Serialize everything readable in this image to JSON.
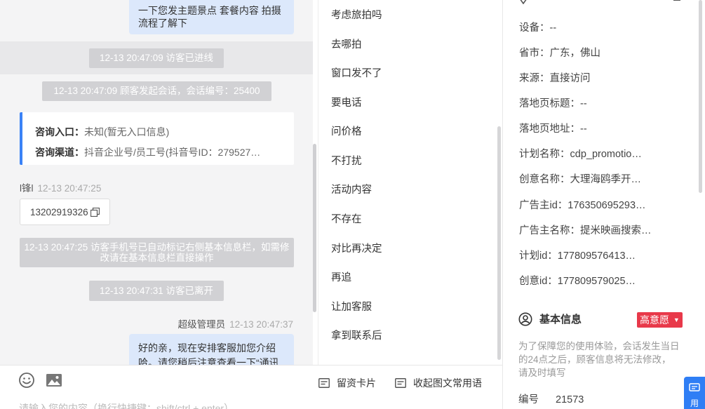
{
  "chat": {
    "bubble_top": "一下您发主题景点 套餐内容 拍摄流程了解下",
    "sys_visitor_in": "12-13 20:47:09 访客已进线",
    "sys_session_start": "12-13 20:47:09 顾客发起会话，会话编号：25400",
    "info_card": {
      "entry_label": "咨询入口：",
      "entry_value": "未知(暂无入口信息)",
      "channel_label": "咨询渠道：",
      "channel_value": "抖音企业号/员工号(抖音号ID：279527…"
    },
    "visitor_name": "l锋l",
    "visitor_time": "12-13 20:47:25",
    "visitor_phone": "13202919326",
    "sys_phone_marked": "12-13 20:47:25 访客手机号已自动标记右侧基本信息栏，如需修改请在基本信息栏直接操作",
    "sys_visitor_left": "12-13 20:47:31 访客已离开",
    "admin_name": "超级管理员",
    "admin_time": "12-13 20:47:37",
    "bubble_admin": "好的亲，现在安排客服加您介绍哈。请您稍后注意查看一下“通讯"
  },
  "input": {
    "emoji_icon": "smile-icon",
    "image_icon": "image-icon",
    "card_label": "留资卡片",
    "collapse_label": "收起图文常用语",
    "placeholder": "请输入您的内容（换行快捷键：shift/ctrl + enter）"
  },
  "quick_replies": [
    "考虑旅拍吗",
    "去哪拍",
    "窗口发不了",
    "要电话",
    "问价格",
    "不打扰",
    "活动内容",
    "不存在",
    "对比再决定",
    "再追",
    "让加客服",
    "拿到联系后"
  ],
  "panel": {
    "fields": [
      "设备：--",
      "省市：广东，佛山",
      "来源：直接访问",
      "落地页标题：--",
      "落地页地址：--",
      "计划名称：cdp_promotio…",
      "创意名称：大理海鸥季开…",
      "广告主id：176350695293…",
      "广告主名称：提米映画搜索…",
      "计划id：177809576413…",
      "创意id：177809579025…"
    ],
    "basic_info_title": "基本信息",
    "intent_badge": "高意愿",
    "notice": "为了保障您的使用体验，会话发生当日的24点之后，顾客信息将无法修改，请及时填写",
    "number_label": "编号",
    "number_value": "21573",
    "float_button_label": "用"
  },
  "colors": {
    "accent": "#3a82f6",
    "bubble": "#dce8fb",
    "system_msg": "#d1d1d4",
    "badge": "#e8394a"
  }
}
